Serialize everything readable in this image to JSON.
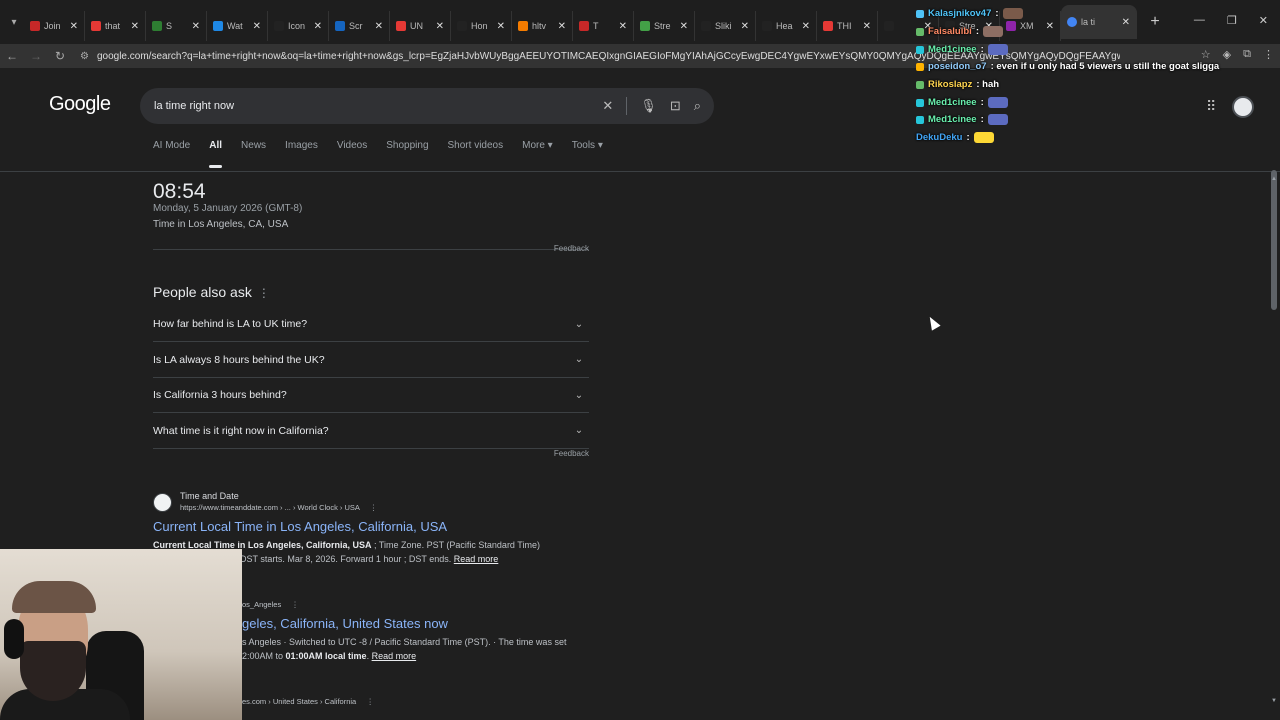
{
  "browser": {
    "tabs": [
      {
        "label": "Join",
        "color": "#c62828"
      },
      {
        "label": "that",
        "color": "#e53935"
      },
      {
        "label": "S",
        "color": "#2e7d32"
      },
      {
        "label": "Wat",
        "color": "#1e88e5"
      },
      {
        "label": "Icon",
        "color": "#222222"
      },
      {
        "label": "Scr",
        "color": "#1565c0"
      },
      {
        "label": "UN",
        "color": "#e53935"
      },
      {
        "label": "Hon",
        "color": "#222222"
      },
      {
        "label": "hltv",
        "color": "#f57c00"
      },
      {
        "label": "T",
        "color": "#c62828"
      },
      {
        "label": "Stre",
        "color": "#43a047"
      },
      {
        "label": "Sliki",
        "color": "#222222"
      },
      {
        "label": "Hea",
        "color": "#222222"
      },
      {
        "label": "THI",
        "color": "#e53935"
      },
      {
        "label": "",
        "color": "#222222"
      },
      {
        "label": "Stre",
        "color": "#222222"
      },
      {
        "label": "XM",
        "color": "#8e24aa"
      }
    ],
    "active_tab": {
      "label": "la ti",
      "color": "#4285f4"
    },
    "url": "google.com/search?q=la+time+right+now&oq=la+time+right+now&gs_lcrp=EgZjaHJvbWUyBggAEEUYOTIMCAEQIxgnGIAEGIoFMgYIAhAjGCcyEwgDEC4YgwEYxwEYsQMY0QMYgAQyDQgEEAAYgwEYsQMYgAQyDQgFEAAYgwEYsQMYgAQ..."
  },
  "google": {
    "logo": "Google",
    "query": "la time right now",
    "nav_tabs": [
      "AI Mode",
      "All",
      "News",
      "Images",
      "Videos",
      "Shopping",
      "Short videos",
      "More ▾",
      "Tools ▾"
    ],
    "active_nav": "All"
  },
  "time_card": {
    "time": "08:54",
    "date": "Monday, 5 January 2026 (GMT-8)",
    "location": "Time in Los Angeles, CA, USA",
    "feedback": "Feedback"
  },
  "paa": {
    "title": "People also ask",
    "questions": [
      "How far behind is LA to UK time?",
      "Is LA always 8 hours behind the UK?",
      "Is California 3 hours behind?",
      "What time is it right now in California?"
    ],
    "feedback": "Feedback"
  },
  "results": [
    {
      "source": "Time and Date",
      "url": "https://www.timeanddate.com › ... › World Clock › USA",
      "title": "Current Local Time in Los Angeles, California, USA",
      "snippet_bold": "Current Local Time in Los Angeles, California, USA",
      "snippet_rest": " ; Time Zone. PST (Pacific Standard Time)",
      "snippet_line2": "DST starts. Mar 8, 2026. Forward 1 hour ; DST ends.",
      "read_more": "Read more"
    },
    {
      "source": "",
      "url": "os_Angeles",
      "title": "geles, California, United States now",
      "snippet_line1": "s Angeles · Switched to UTC -8 / Pacific Standard Time (PST). · The time was set",
      "snippet_line2_pre": "2:00AM to ",
      "snippet_line2_bold": "01:00AM local time",
      "snippet_line2_post": ".",
      "read_more": "Read more"
    },
    {
      "url": "es.com › United States › California"
    }
  ],
  "chat": [
    {
      "user": "Kalasjnikov47",
      "text": ":",
      "user_color": "#4fc3f7",
      "badge": "#4fc3f7",
      "emote": "#7a5a4a"
    },
    {
      "user": "Faisaluibi",
      "text": ":",
      "user_color": "#ff8a65",
      "badge": "#66bb6a",
      "emote": "#8d6e63"
    },
    {
      "user": "Med1cinee",
      "text": ":",
      "user_color": "#69f0ae",
      "badge": "#26c6da",
      "emote": "#5c6bc0"
    },
    {
      "user": "poseidon_o7",
      "text": ": even if u only had 5 viewers u still the goat sliggа",
      "user_color": "#90caf9",
      "badge": "#ffb300",
      "emote": ""
    },
    {
      "user": "Rikoslapz",
      "text": ": hah",
      "user_color": "#ffd54f",
      "badge": "#66bb6a",
      "emote": ""
    },
    {
      "user": "Med1cinee",
      "text": ":",
      "user_color": "#69f0ae",
      "badge": "#26c6da",
      "emote": "#5c6bc0"
    },
    {
      "user": "Med1cinee",
      "text": ":",
      "user_color": "#69f0ae",
      "badge": "#26c6da",
      "emote": "#5c6bc0"
    },
    {
      "user": "DekuDeku",
      "text": ":",
      "user_color": "#42a5f5",
      "badge": "",
      "emote": "#fdd835"
    }
  ]
}
